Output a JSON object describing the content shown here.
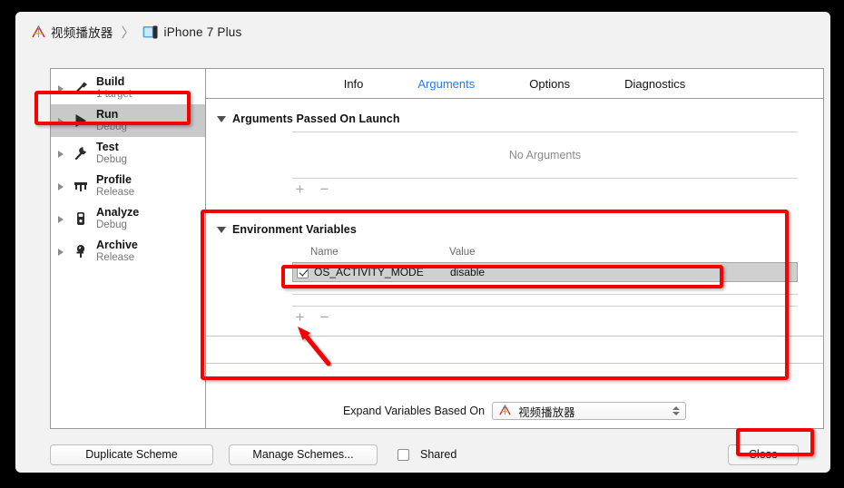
{
  "breadcrumb": {
    "project_icon": "xcode-icon",
    "project": "视频播放器",
    "separator": "〉",
    "device_icon": "device-icon",
    "device": "iPhone 7 Plus"
  },
  "sidebar": {
    "items": [
      {
        "icon": "hammer-icon",
        "title": "Build",
        "subtitle": "1 target",
        "selected": false
      },
      {
        "icon": "play-icon",
        "title": "Run",
        "subtitle": "Debug",
        "selected": true
      },
      {
        "icon": "wrench-icon",
        "title": "Test",
        "subtitle": "Debug",
        "selected": false
      },
      {
        "icon": "gauge-icon",
        "title": "Profile",
        "subtitle": "Release",
        "selected": false
      },
      {
        "icon": "magnifier-icon",
        "title": "Analyze",
        "subtitle": "Debug",
        "selected": false
      },
      {
        "icon": "archive-icon",
        "title": "Archive",
        "subtitle": "Release",
        "selected": false
      }
    ]
  },
  "tabs": [
    {
      "label": "Info",
      "active": false
    },
    {
      "label": "Arguments",
      "active": true
    },
    {
      "label": "Options",
      "active": false
    },
    {
      "label": "Diagnostics",
      "active": false
    }
  ],
  "arguments_section": {
    "title": "Arguments Passed On Launch",
    "empty_text": "No Arguments",
    "add_label": "+",
    "remove_label": "−"
  },
  "env_section": {
    "title": "Environment Variables",
    "columns": {
      "name": "Name",
      "value": "Value"
    },
    "rows": [
      {
        "enabled": true,
        "name": "OS_ACTIVITY_MODE",
        "value": "disable",
        "selected": true
      }
    ],
    "add_label": "+",
    "remove_label": "−"
  },
  "expand_variables": {
    "label": "Expand Variables Based On",
    "selected": "视频播放器",
    "icon": "xcode-icon"
  },
  "toolbar": {
    "duplicate_label": "Duplicate Scheme",
    "manage_label": "Manage Schemes...",
    "shared_label": "Shared",
    "shared_checked": false,
    "close_label": "Close"
  },
  "annotations": {
    "color": "#f70000",
    "boxes": [
      "run-scheme-item",
      "environment-variables-section",
      "environment-variable-row",
      "close-button"
    ],
    "arrow": {
      "points_to": "add-environment-variable-button"
    }
  }
}
